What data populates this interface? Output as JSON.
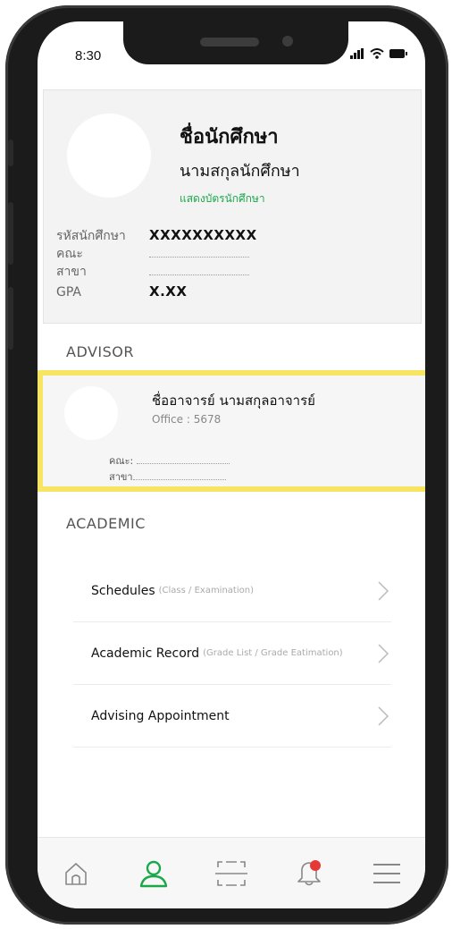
{
  "status_bar": {
    "time": "8:30"
  },
  "profile": {
    "first_name": "ชื่อนักศึกษา",
    "last_name": "นามสกุลนักศึกษา",
    "card_link": "แสดงบัตรนักศึกษา",
    "fields": [
      {
        "label": "รหัสนักศึกษา",
        "value": "XXXXXXXXXX"
      },
      {
        "label": "คณะ",
        "value": ""
      },
      {
        "label": "สาขา",
        "value": ""
      },
      {
        "label": "GPA",
        "value": "X.XX"
      }
    ]
  },
  "advisor_section_title": "ADVISOR",
  "advisor": {
    "name": "ชื่ออาจารย์  นามสกุลอาจารย์",
    "office": "Office : 5678",
    "faculty_label": "คณะ",
    "major_label": "สาขา"
  },
  "academic_section_title": "ACADEMIC",
  "menu": [
    {
      "title": "Schedules",
      "subtitle": "(Class / Examination)"
    },
    {
      "title": "Academic Record",
      "subtitle": "(Grade List / Grade Eatimation)"
    },
    {
      "title": "Advising Appointment",
      "subtitle": ""
    }
  ],
  "bottom_nav": [
    {
      "icon": "home-icon"
    },
    {
      "icon": "profile-icon",
      "active": true
    },
    {
      "icon": "scan-icon"
    },
    {
      "icon": "bell-icon",
      "badge": true
    },
    {
      "icon": "menu-icon"
    }
  ],
  "colors": {
    "accent": "#1aa84a",
    "highlight": "#f7e460",
    "badge": "#e53935"
  }
}
